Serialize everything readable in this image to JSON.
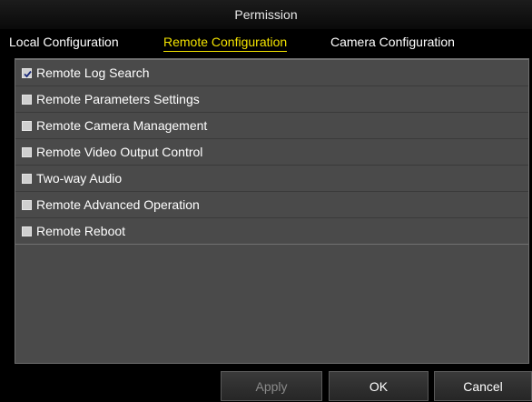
{
  "window": {
    "title": "Permission"
  },
  "tabs": [
    {
      "label": "Local Configuration",
      "active": false
    },
    {
      "label": "Remote Configuration",
      "active": true
    },
    {
      "label": "Camera Configuration",
      "active": false
    }
  ],
  "permissions": [
    {
      "label": "Remote Log Search",
      "checked": true
    },
    {
      "label": "Remote Parameters Settings",
      "checked": false
    },
    {
      "label": "Remote Camera Management",
      "checked": false
    },
    {
      "label": "Remote Video Output Control",
      "checked": false
    },
    {
      "label": "Two-way Audio",
      "checked": false
    },
    {
      "label": "Remote Advanced Operation",
      "checked": false
    },
    {
      "label": "Remote Reboot",
      "checked": false
    }
  ],
  "buttons": {
    "apply": {
      "label": "Apply",
      "enabled": false
    },
    "ok": {
      "label": "OK",
      "enabled": true
    },
    "cancel": {
      "label": "Cancel",
      "enabled": true
    }
  },
  "colors": {
    "active_tab": "#f2e200",
    "panel_background": "#4a4a4a",
    "window_background": "#000000"
  }
}
